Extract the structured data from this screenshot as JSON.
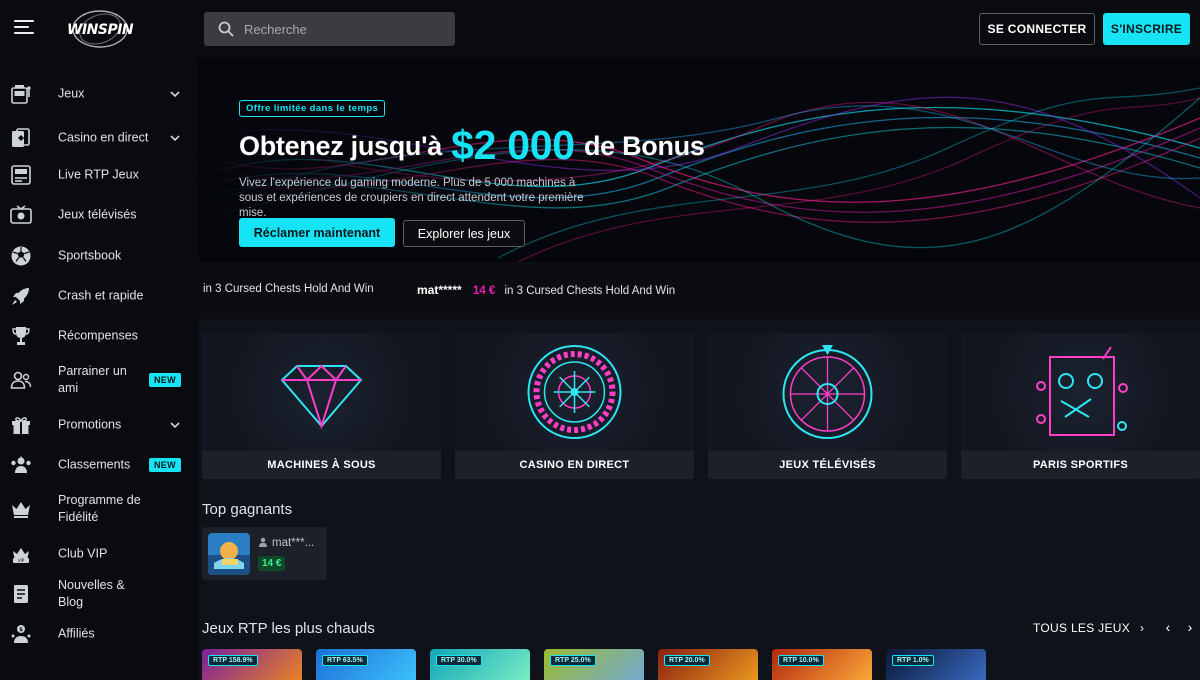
{
  "header": {
    "logo_text_win": "WIN",
    "logo_text_spin": "SPIN",
    "search_placeholder": "Recherche",
    "login_label": "SE CONNECTER",
    "signup_label": "S'INSCRIRE"
  },
  "sidebar": {
    "items": [
      {
        "label": "Jeux",
        "icon": "slot-machine-icon",
        "chevron": true
      },
      {
        "label": "Casino en direct",
        "icon": "live-cards-icon",
        "chevron": true
      },
      {
        "label": "Live RTP Jeux",
        "icon": "rtp-icon"
      },
      {
        "label": "Jeux télévisés",
        "icon": "tv-icon"
      },
      {
        "label": "Sportsbook",
        "icon": "soccer-ball-icon"
      },
      {
        "label": "Crash et rapide",
        "icon": "rocket-icon"
      },
      {
        "label": "Récompenses",
        "icon": "trophy-icon"
      },
      {
        "label": "Parrainer un ami",
        "icon": "refer-friend-icon",
        "badge": "NEW"
      },
      {
        "label": "Promotions",
        "icon": "gift-icon",
        "chevron": true
      },
      {
        "label": "Classements",
        "icon": "leaderboard-icon",
        "badge": "NEW"
      },
      {
        "label": "Programme de Fidélité",
        "icon": "crown-icon"
      },
      {
        "label": "Club VIP",
        "icon": "vip-icon"
      },
      {
        "label": "Nouvelles & Blog",
        "icon": "news-icon"
      },
      {
        "label": "Affiliés",
        "icon": "affiliate-icon"
      }
    ]
  },
  "hero": {
    "tag": "Offre limitée dans le temps",
    "title_prefix": "Obtenez jusqu'à",
    "title_amount": "$2 000",
    "title_suffix": "de Bonus",
    "description": "Vivez l'expérience du gaming moderne. Plus de 5 000 machines à sous et expériences de croupiers en direct attendent votre première mise.",
    "claim_label": "Réclamer maintenant",
    "explore_label": "Explorer les jeux"
  },
  "ticker": [
    {
      "user": "",
      "amount": "",
      "game": "in 3 Cursed Chests Hold And Win"
    },
    {
      "user": "mat*****",
      "amount": "14 €",
      "game": "in 3 Cursed Chests Hold And Win"
    }
  ],
  "categories": [
    {
      "label": "MACHINES À SOUS",
      "icon": "diamond-icon"
    },
    {
      "label": "CASINO EN DIRECT",
      "icon": "roulette-icon"
    },
    {
      "label": "JEUX TÉLÉVISÉS",
      "icon": "wheel-icon"
    },
    {
      "label": "PARIS SPORTIFS",
      "icon": "sports-board-icon"
    }
  ],
  "top_winners": {
    "title": "Top gagnants",
    "items": [
      {
        "user": "mat***...",
        "amount": "14 €"
      }
    ]
  },
  "hot_rtp": {
    "title": "Jeux RTP les plus chauds",
    "all_games_label": "TOUS LES JEUX",
    "prev": "‹",
    "next": "›",
    "games": [
      {
        "rtp": "RTP 158.9%",
        "colors": [
          "#7a1f9e",
          "#f08a1e"
        ]
      },
      {
        "rtp": "RTP 63.5%",
        "colors": [
          "#1c6fd6",
          "#3fc7ff"
        ]
      },
      {
        "rtp": "RTP 30.0%",
        "colors": [
          "#12a5b9",
          "#7ff1c4"
        ]
      },
      {
        "rtp": "RTP 25.0%",
        "colors": [
          "#9dbb2e",
          "#6fa8dc"
        ]
      },
      {
        "rtp": "RTP 20.0%",
        "colors": [
          "#8a1f10",
          "#f0a020"
        ]
      },
      {
        "rtp": "RTP 10.0%",
        "colors": [
          "#b3260f",
          "#ffb13a"
        ]
      },
      {
        "rtp": "RTP 1.0%",
        "colors": [
          "#0b1838",
          "#3b6fc8"
        ]
      }
    ]
  }
}
